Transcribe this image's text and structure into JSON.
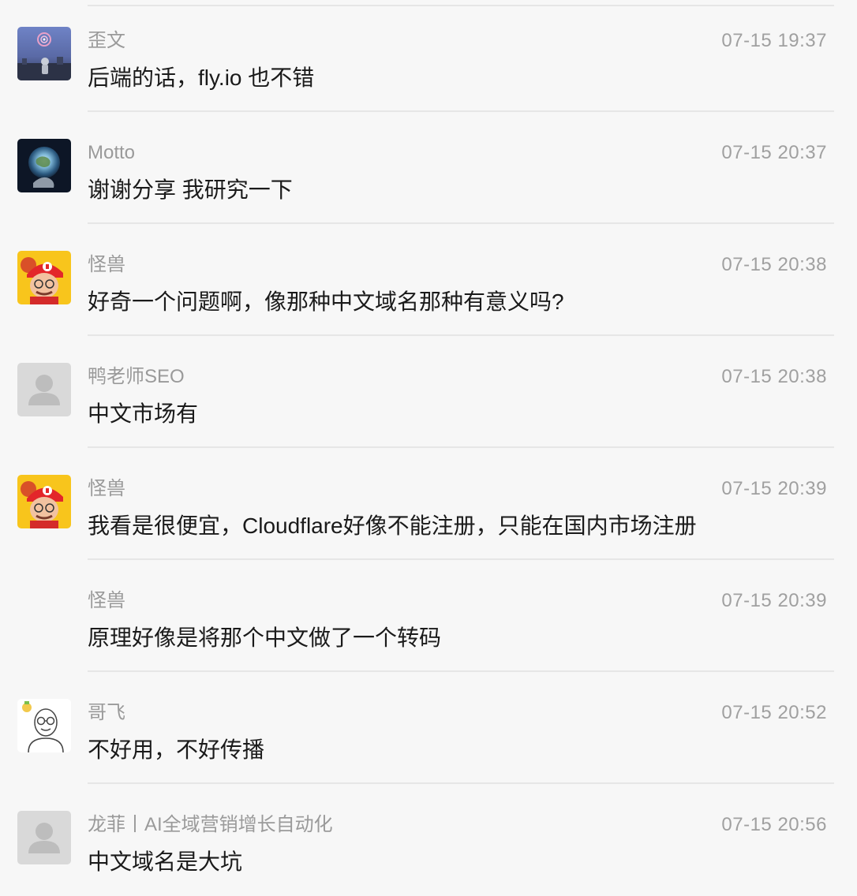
{
  "messages": [
    {
      "name": "歪文",
      "time": "07-15 19:37",
      "text": "后端的话，fly.io 也不错",
      "avatar": "avatar-astronaut-icon"
    },
    {
      "name": "Motto",
      "time": "07-15 20:37",
      "text": "谢谢分享 我研究一下",
      "avatar": "avatar-earth-icon"
    },
    {
      "name": "怪兽",
      "time": "07-15 20:38",
      "text": "好奇一个问题啊，像那种中文域名那种有意义吗?",
      "avatar": "avatar-cartoon-mario-icon"
    },
    {
      "name": "鸭老师SEO",
      "time": "07-15 20:38",
      "text": "中文市场有",
      "avatar": "default-avatar-icon"
    },
    {
      "name": "怪兽",
      "time": "07-15 20:39",
      "text": "我看是很便宜，Cloudflare好像不能注册，只能在国内市场注册",
      "avatar": "avatar-cartoon-mario-icon"
    },
    {
      "name": "怪兽",
      "time": "07-15 20:39",
      "text": "原理好像是将那个中文做了一个转码",
      "avatar": ""
    },
    {
      "name": "哥飞",
      "time": "07-15 20:52",
      "text": "不好用，不好传播",
      "avatar": "avatar-glasses-man-icon"
    },
    {
      "name": "龙菲丨AI全域营销增长自动化",
      "time": "07-15 20:56",
      "text": "中文域名是大坑",
      "avatar": "default-avatar-icon"
    }
  ]
}
